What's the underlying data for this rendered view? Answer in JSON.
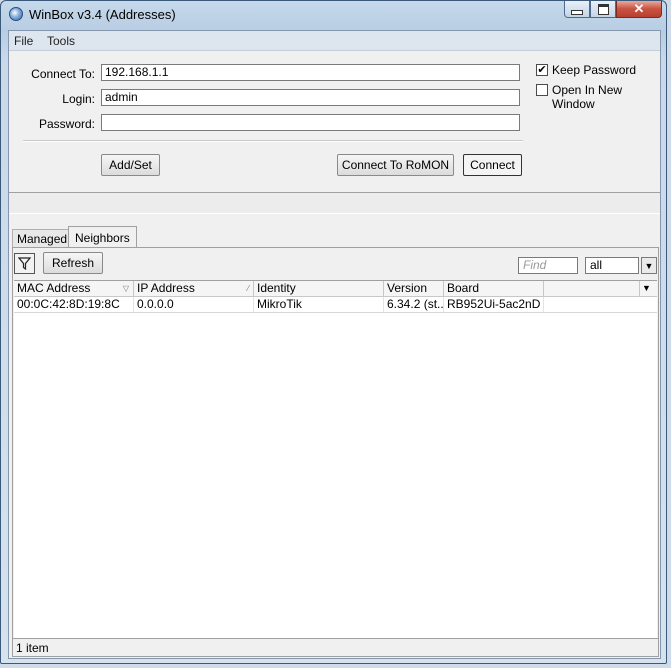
{
  "window": {
    "title": "WinBox v3.4 (Addresses)",
    "close_glyph": "✕"
  },
  "menu": {
    "file": "File",
    "tools": "Tools"
  },
  "form": {
    "connect_to_label": "Connect To:",
    "connect_to_value": "192.168.1.1",
    "login_label": "Login:",
    "login_value": "admin",
    "password_label": "Password:",
    "password_value": "",
    "keep_password_label": "Keep Password",
    "keep_password_checked": "✔",
    "open_new_window_label": "Open In New Window",
    "add_set_label": "Add/Set",
    "romon_label": "Connect To RoMON",
    "connect_label": "Connect"
  },
  "tabs": {
    "managed": "Managed",
    "neighbors": "Neighbors"
  },
  "toolbar": {
    "refresh_label": "Refresh",
    "find_placeholder": "Find",
    "filter_value": "all"
  },
  "table": {
    "columns": [
      "MAC Address",
      "IP Address",
      "Identity",
      "Version",
      "Board"
    ],
    "rows": [
      [
        "00:0C:42:8D:19:8C",
        "0.0.0.0",
        "MikroTik",
        "6.34.2 (st...",
        "RB952Ui-5ac2nD"
      ]
    ]
  },
  "status": {
    "item_count": "1 item"
  }
}
